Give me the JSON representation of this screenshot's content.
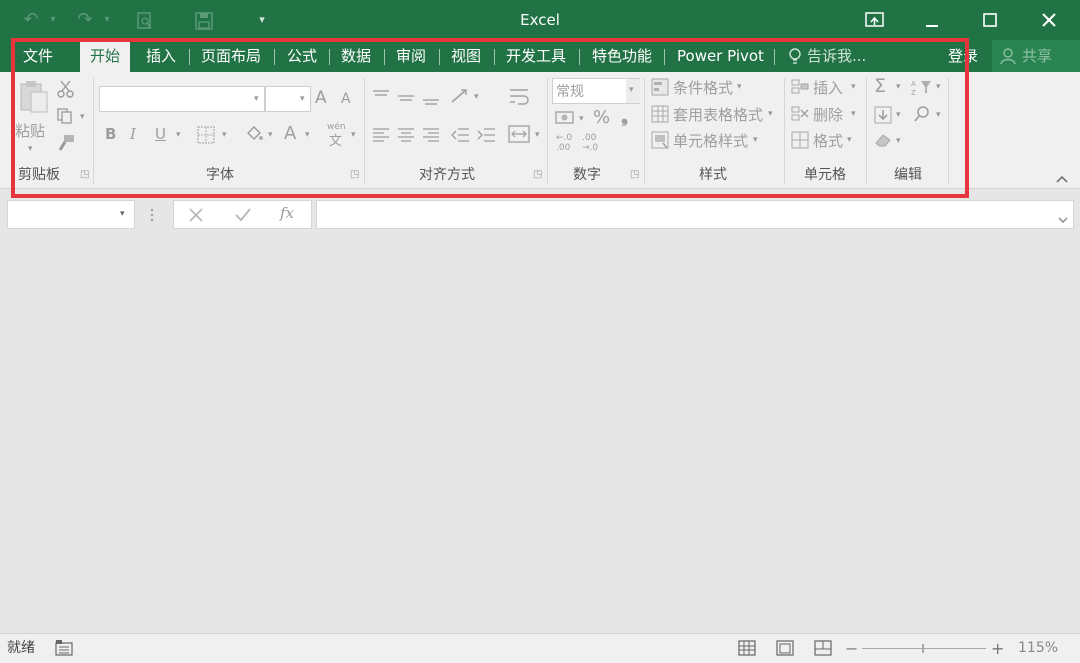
{
  "window": {
    "title": "Excel"
  },
  "tabs": {
    "file": "文件",
    "home": "开始",
    "insert": "插入",
    "page_layout": "页面布局",
    "formulas": "公式",
    "data": "数据",
    "review": "审阅",
    "view": "视图",
    "developer": "开发工具",
    "special": "特色功能",
    "power_pivot": "Power Pivot",
    "tell_me": "告诉我...",
    "sign_in": "登录",
    "share": "共享"
  },
  "ribbon": {
    "clipboard": {
      "paste": "粘贴",
      "label": "剪贴板"
    },
    "font": {
      "label": "字体",
      "bold": "B",
      "italic": "I",
      "underline": "U",
      "grow": "A",
      "shrink": "A",
      "color": "A",
      "phonetic_top": "wén",
      "phonetic_bottom": "文"
    },
    "alignment": {
      "label": "对齐方式"
    },
    "number": {
      "format": "常规",
      "percent": "%",
      "comma": "❟",
      "inc_dec_1": "←.0",
      "inc_dec_2": ".00",
      "dec_dec_1": ".00",
      "dec_dec_2": "→.0",
      "label": "数字"
    },
    "styles": {
      "conditional": "条件格式",
      "table": "套用表格格式",
      "cell_styles": "单元格样式",
      "label": "样式"
    },
    "cells": {
      "insert": "插入",
      "delete": "删除",
      "format": "格式",
      "label": "单元格"
    },
    "editing": {
      "sum": "Σ",
      "label": "编辑"
    }
  },
  "formula_bar": {
    "fx": "fx"
  },
  "status": {
    "ready": "就绪",
    "zoom": "115%",
    "minus": "−",
    "plus": "+"
  },
  "colors": {
    "accent": "#217346",
    "highlight": "#e8353d"
  }
}
